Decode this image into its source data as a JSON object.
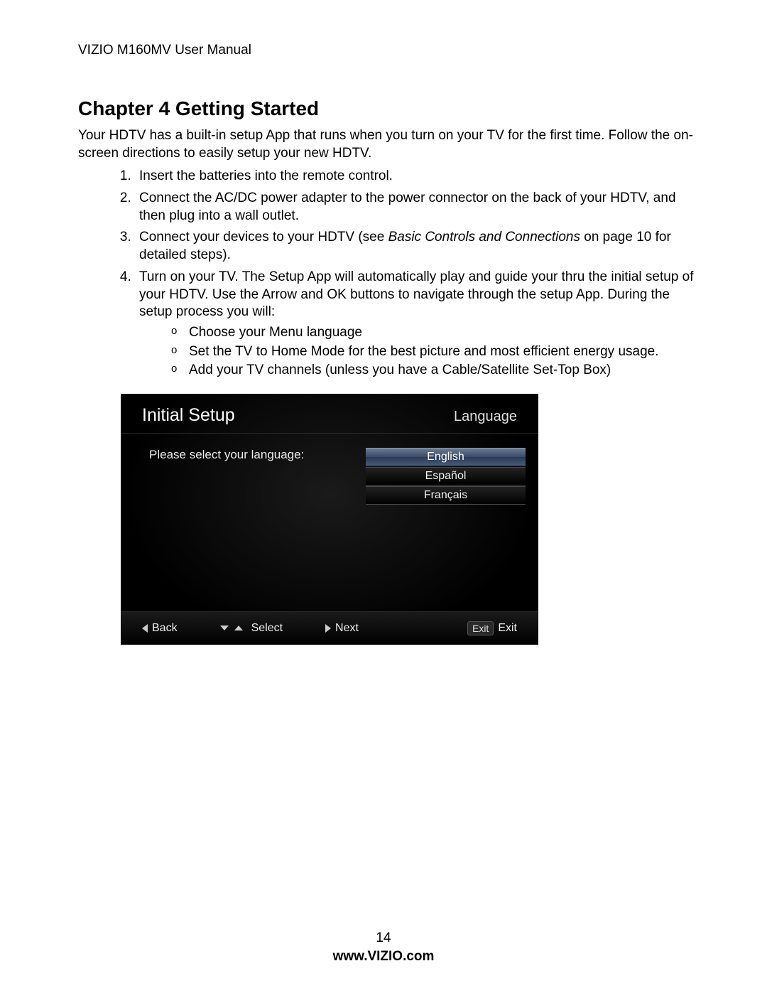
{
  "header": "VIZIO M160MV User Manual",
  "chapter_title": "Chapter 4 Getting Started",
  "intro": "Your HDTV has a built-in setup App that runs when you turn on your TV for the first time. Follow the on-screen directions to easily setup your new HDTV.",
  "steps": {
    "s1": "Insert the batteries into the remote control.",
    "s2": "Connect the AC/DC power adapter to the power connector on the back of your HDTV, and then plug into a wall outlet.",
    "s3_pre": "Connect your devices to your HDTV (see ",
    "s3_italic": "Basic Controls and Connections",
    "s3_post": " on page 10 for detailed steps).",
    "s4": "Turn on your TV. The Setup App will automatically play and guide your thru the initial setup of your HDTV. Use the Arrow and OK buttons to navigate through the setup App. During the setup process you will:",
    "s4_sub": {
      "a": "Choose your Menu language",
      "b": "Set the TV to Home Mode for the best picture and most efficient energy usage.",
      "c": "Add your TV channels (unless you have a Cable/Satellite Set-Top Box)"
    }
  },
  "tv": {
    "title": "Initial Setup",
    "section": "Language",
    "prompt": "Please select your language:",
    "languages": {
      "l0": "English",
      "l1": "Español",
      "l2": "Français"
    },
    "nav": {
      "back": "Back",
      "select": "Select",
      "next": "Next",
      "exit_key": "Exit",
      "exit": "Exit"
    }
  },
  "footer": {
    "page": "14",
    "site": "www.VIZIO.com"
  }
}
